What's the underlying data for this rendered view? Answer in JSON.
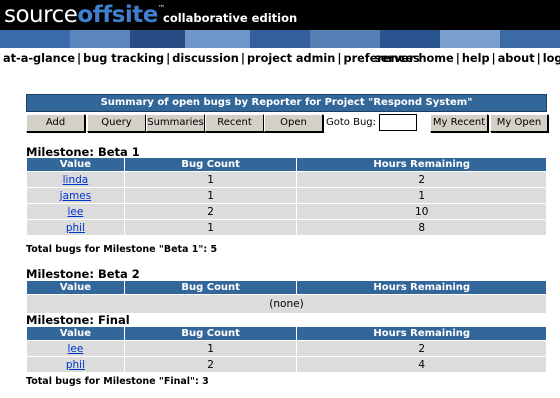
{
  "app": {
    "brand_part1": "source",
    "brand_part2": "offsite",
    "trademark": "™",
    "edition": "collaborative edition"
  },
  "nav": {
    "left": [
      "at-a-glance",
      "bug tracking",
      "discussion",
      "project admin",
      "preferences"
    ],
    "right": [
      "server home",
      "help",
      "about",
      "logout"
    ]
  },
  "summary": {
    "title": "Summary of open bugs by Reporter for Project \"Respond System\"",
    "buttons": {
      "add": "Add",
      "query": "Query",
      "summaries": "Summaries",
      "recent": "Recent",
      "open": "Open",
      "my_recent": "My Recent",
      "my_open": "My Open"
    },
    "goto_label": "Goto Bug:",
    "goto_value": ""
  },
  "columns": [
    "Value",
    "Bug Count",
    "Hours Remaining"
  ],
  "milestones": {
    "beta1": {
      "title": "Milestone: Beta 1",
      "rows": [
        {
          "value": "linda",
          "bug_count": "1",
          "hours": "2"
        },
        {
          "value": "james",
          "bug_count": "1",
          "hours": "1"
        },
        {
          "value": "lee",
          "bug_count": "2",
          "hours": "10"
        },
        {
          "value": "phil",
          "bug_count": "1",
          "hours": "8"
        }
      ],
      "total": "Total bugs for Milestone \"Beta 1\": 5"
    },
    "beta2": {
      "title": "Milestone: Beta 2",
      "empty_text": "(none)"
    },
    "final": {
      "title": "Milestone: Final",
      "rows": [
        {
          "value": "lee",
          "bug_count": "1",
          "hours": "2"
        },
        {
          "value": "phil",
          "bug_count": "2",
          "hours": "4"
        }
      ],
      "total": "Total bugs for Milestone \"Final\": 3"
    }
  },
  "colors": {
    "header_blue": "#336699",
    "row_gray": "#dcdcdc",
    "link_blue": "#0033cc",
    "brand_blue": "#3f7fd0"
  }
}
